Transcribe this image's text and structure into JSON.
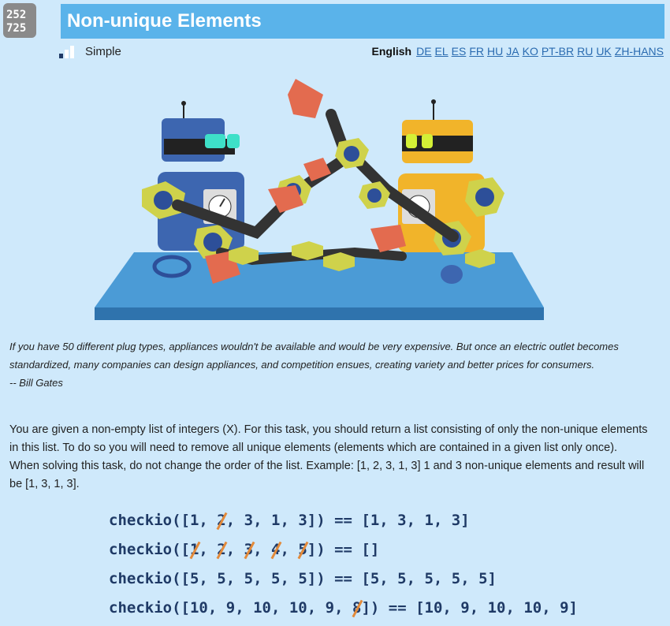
{
  "header": {
    "logo_icon": "number-grid-logo",
    "title": "Non-unique Elements"
  },
  "level": {
    "label": "Simple",
    "icon": "difficulty-bars-icon"
  },
  "languages": {
    "current": "English",
    "options": [
      "DE",
      "EL",
      "ES",
      "FR",
      "HU",
      "JA",
      "KO",
      "PT-BR",
      "RU",
      "UK",
      "ZH-HANS"
    ]
  },
  "quote": {
    "text": "If you have 50 different plug types, appliances wouldn't be available and would be very expensive. But once an electric outlet becomes standardized, many companies can design appliances, and competition ensues, creating variety and better prices for consumers.",
    "author": "-- Bill Gates"
  },
  "description": "You are given a non-empty list of integers (X). For this task, you should return a list consisting of only the non-unique elements in this list. To do so you will need to remove all unique elements (elements which are contained in a given list only once). When solving this task, do not change the order of the list. Example: [1, 2, 3, 1, 3] 1 and 3 non-unique elements and result will be [1, 3, 1, 3].",
  "examples": [
    {
      "prefix": "checkio([",
      "items": [
        {
          "v": "1",
          "s": false
        },
        {
          "v": "2",
          "s": true
        },
        {
          "v": "3",
          "s": false
        },
        {
          "v": "1",
          "s": false
        },
        {
          "v": "3",
          "s": false
        }
      ],
      "suffix": "]) == [1, 3, 1, 3]"
    },
    {
      "prefix": "checkio([",
      "items": [
        {
          "v": "1",
          "s": true
        },
        {
          "v": "2",
          "s": true
        },
        {
          "v": "3",
          "s": true
        },
        {
          "v": "4",
          "s": true
        },
        {
          "v": "5",
          "s": true
        }
      ],
      "suffix": "]) == []"
    },
    {
      "prefix": "checkio([",
      "items": [
        {
          "v": "5",
          "s": false
        },
        {
          "v": "5",
          "s": false
        },
        {
          "v": "5",
          "s": false
        },
        {
          "v": "5",
          "s": false
        },
        {
          "v": "5",
          "s": false
        }
      ],
      "suffix": "]) == [5, 5, 5, 5, 5]"
    },
    {
      "prefix": "checkio([",
      "items": [
        {
          "v": "10",
          "s": false
        },
        {
          "v": "9",
          "s": false
        },
        {
          "v": "10",
          "s": false
        },
        {
          "v": "10",
          "s": false
        },
        {
          "v": "9",
          "s": false
        },
        {
          "v": "8",
          "s": true
        }
      ],
      "suffix": "]) == [10, 9, 10, 10, 9]"
    }
  ],
  "colors": {
    "background": "#cfe9fb",
    "title_bar": "#5ab3ea",
    "strike": "#e38a3a",
    "code": "#1f3a66"
  }
}
